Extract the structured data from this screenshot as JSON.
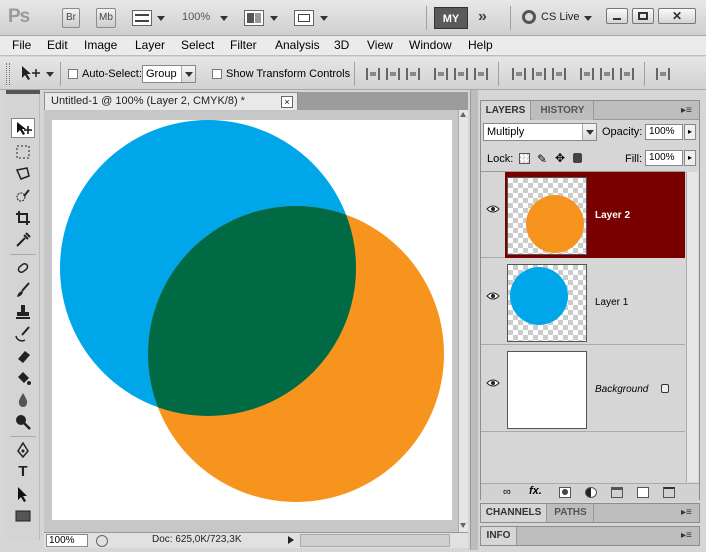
{
  "appbar": {
    "logo": "Ps",
    "bridge": "Br",
    "minibridge": "Mb",
    "zoom": "100%",
    "workspace": "MY",
    "cslive": "CS Live"
  },
  "menu": [
    "File",
    "Edit",
    "Image",
    "Layer",
    "Select",
    "Filter",
    "Analysis",
    "3D",
    "View",
    "Window",
    "Help"
  ],
  "options": {
    "auto_select_label": "Auto-Select:",
    "auto_select_value": "Group",
    "show_transform_label": "Show Transform Controls"
  },
  "document": {
    "tab_title": "Untitled-1 @ 100% (Layer 2, CMYK/8) *",
    "close": "×",
    "zoom": "100%",
    "doc_info": "Doc: 625,0K/723,3K"
  },
  "colors": {
    "cyan": "#00a6ea",
    "orange": "#f7941d",
    "overlap": "#006a45",
    "selected_layer": "#7a0000"
  },
  "layers_panel": {
    "tab_layers": "LAYERS",
    "tab_history": "HISTORY",
    "blend_mode": "Multiply",
    "opacity_label": "Opacity:",
    "opacity_value": "100%",
    "lock_label": "Lock:",
    "fill_label": "Fill:",
    "fill_value": "100%",
    "layers": [
      {
        "name": "Layer 2",
        "selected": true
      },
      {
        "name": "Layer 1",
        "selected": false
      },
      {
        "name": "Background",
        "selected": false
      }
    ]
  },
  "channels_panel": {
    "tab_channels": "CHANNELS",
    "tab_paths": "PATHS"
  },
  "info_panel": {
    "tab_info": "INFO"
  }
}
